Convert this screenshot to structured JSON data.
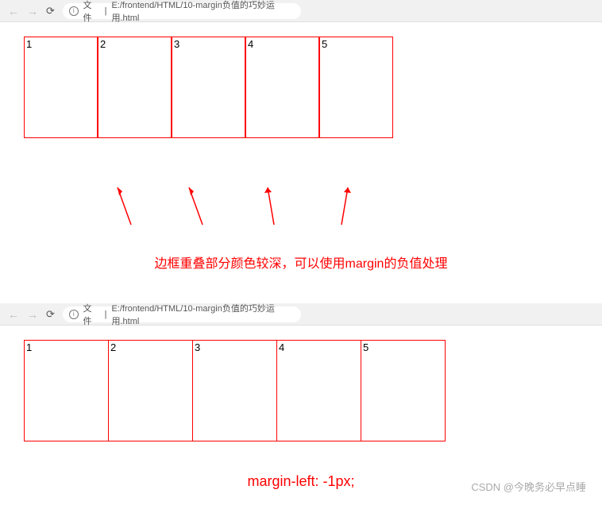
{
  "browser1": {
    "file_prefix": "文件",
    "url": "E:/frontend/HTML/10-margin负值的巧妙运用.html"
  },
  "browser2": {
    "file_prefix": "文件",
    "url": "E:/frontend/HTML/10-margin负值的巧妙运用.html"
  },
  "boxes1": [
    "1",
    "2",
    "3",
    "4",
    "5"
  ],
  "boxes2": [
    "1",
    "2",
    "3",
    "4",
    "5"
  ],
  "caption1": "边框重叠部分颜色较深，可以使用margin的负值处理",
  "caption2": "margin-left: -1px;",
  "watermark": "CSDN @今晚务必早点睡"
}
